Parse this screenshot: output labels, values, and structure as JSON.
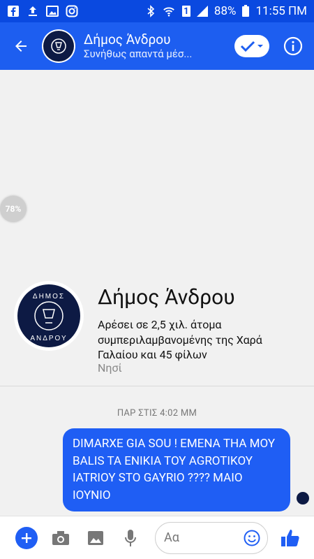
{
  "status_bar": {
    "battery": "88%",
    "time": "11:55 ΠΜ",
    "sim_label": "1"
  },
  "header": {
    "title": "Δήμος Άνδρου",
    "subtitle": "Συνήθως απαντά μέσ...",
    "accent": "#1d5ef0"
  },
  "zoom_badge": {
    "value": "78%"
  },
  "profile": {
    "name": "Δήμος Άνδρου",
    "description": "Αρέσει σε 2,5 χιλ. άτομα συμπεριλαμβανομένης της Χαρά Γαλαίου και 45 φίλων",
    "type": "Νησί",
    "avatar_line1": "ΔΗΜΟΣ",
    "avatar_line2": "ΑΝΔΡΟΥ"
  },
  "conversation": {
    "timestamp": "ΠΑΡ ΣΤΙΣ 4:02 ΜΜ",
    "message": "DIMARXE GIA SOU !  EMENA ΤΗΑ ΜΟΥ BALIS TA ENIKIA TOY AGROTIKOY IATRIOY STO GAYRIO ???? ΜΑΙΟ ΙΟΥΝΙΟ"
  },
  "composer": {
    "placeholder": "Αα"
  }
}
